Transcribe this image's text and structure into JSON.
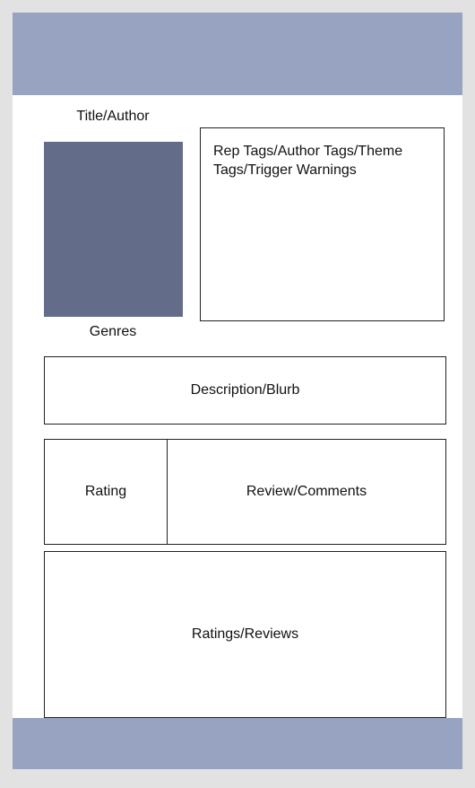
{
  "colors": {
    "background": "#e2e2e2",
    "page": "#ffffff",
    "header_footer": "#97a3c0",
    "cover_placeholder": "#636d89",
    "border": "#222222"
  },
  "book": {
    "title_author": "Title/Author",
    "genres": "Genres",
    "tags": "Rep  Tags/Author Tags/Theme Tags/Trigger Warnings",
    "description": "Description/Blurb"
  },
  "review_form": {
    "rating_label": "Rating",
    "comments_label": "Review/Comments"
  },
  "reviews": {
    "label": "Ratings/Reviews"
  }
}
